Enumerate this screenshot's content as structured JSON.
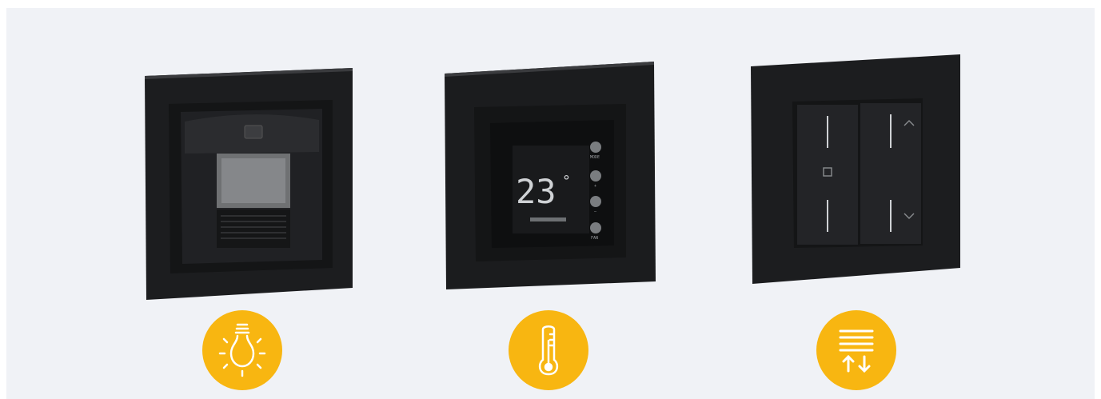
{
  "colors": {
    "background": "#f0f2f6",
    "device_frame": "#1e1f21",
    "badge": "#f8b611",
    "icon_stroke": "#ffffff"
  },
  "devices": [
    {
      "name": "motion-sensor",
      "icon": "light-bulb-icon"
    },
    {
      "name": "thermostat",
      "icon": "thermometer-icon",
      "display_temperature": "23",
      "display_unit": "°",
      "button_labels": [
        "MODE",
        "+",
        "–",
        "FAN"
      ]
    },
    {
      "name": "blind-switch",
      "icon": "blinds-up-down-icon"
    }
  ]
}
